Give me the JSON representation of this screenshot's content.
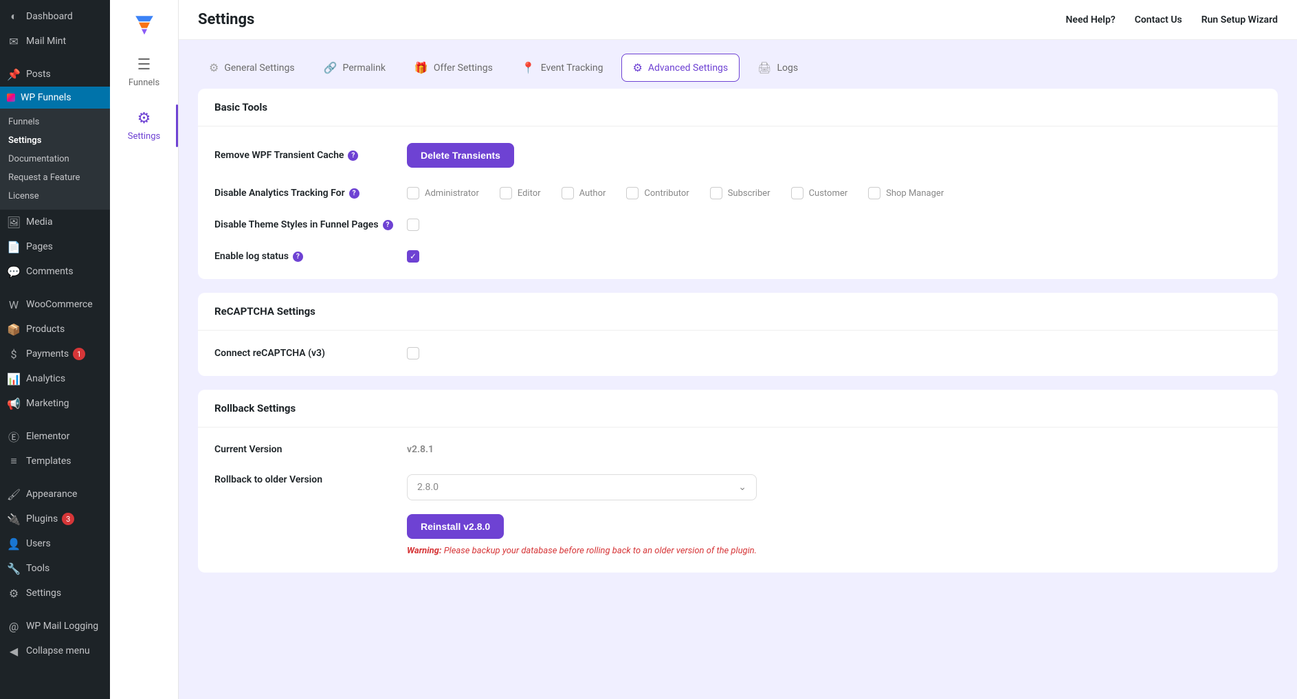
{
  "wp_sidebar": {
    "items": [
      {
        "label": "Dashboard",
        "icon": "◐"
      },
      {
        "label": "Mail Mint",
        "icon": "✉"
      },
      {
        "label": "Posts",
        "icon": "📌",
        "sep_before": true
      },
      {
        "label": "WP Funnels",
        "icon": "funnel",
        "active": true,
        "submenu": [
          {
            "label": "Funnels"
          },
          {
            "label": "Settings",
            "current": true
          },
          {
            "label": "Documentation"
          },
          {
            "label": "Request a Feature"
          },
          {
            "label": "License"
          }
        ]
      },
      {
        "label": "Media",
        "icon": "🖼"
      },
      {
        "label": "Pages",
        "icon": "📄"
      },
      {
        "label": "Comments",
        "icon": "💬"
      },
      {
        "label": "WooCommerce",
        "icon": "W",
        "sep_before": true
      },
      {
        "label": "Products",
        "icon": "📦"
      },
      {
        "label": "Payments",
        "icon": "$",
        "badge": "1"
      },
      {
        "label": "Analytics",
        "icon": "📊"
      },
      {
        "label": "Marketing",
        "icon": "📢"
      },
      {
        "label": "Elementor",
        "icon": "Ⓔ",
        "sep_before": true
      },
      {
        "label": "Templates",
        "icon": "≡"
      },
      {
        "label": "Appearance",
        "icon": "🖌",
        "sep_before": true
      },
      {
        "label": "Plugins",
        "icon": "🔌",
        "badge": "3"
      },
      {
        "label": "Users",
        "icon": "👤"
      },
      {
        "label": "Tools",
        "icon": "🔧"
      },
      {
        "label": "Settings",
        "icon": "⚙"
      },
      {
        "label": "WP Mail Logging",
        "icon": "@",
        "sep_before": true
      },
      {
        "label": "Collapse menu",
        "icon": "◀"
      }
    ]
  },
  "secondary_sidebar": {
    "items": [
      {
        "label": "Funnels",
        "icon": "☰"
      },
      {
        "label": "Settings",
        "icon": "⚙",
        "active": true
      }
    ]
  },
  "topbar": {
    "title": "Settings",
    "links": [
      {
        "label": "Need Help?"
      },
      {
        "label": "Contact Us"
      },
      {
        "label": "Run Setup Wizard"
      }
    ]
  },
  "tabs": [
    {
      "label": "General Settings",
      "icon": "⚙"
    },
    {
      "label": "Permalink",
      "icon": "🔗"
    },
    {
      "label": "Offer Settings",
      "icon": "🎁"
    },
    {
      "label": "Event Tracking",
      "icon": "📍"
    },
    {
      "label": "Advanced Settings",
      "icon": "⚙",
      "active": true
    },
    {
      "label": "Logs",
      "icon": "🖨"
    }
  ],
  "basic_tools": {
    "title": "Basic Tools",
    "remove_cache_label": "Remove WPF Transient Cache",
    "delete_button": "Delete Transients",
    "disable_analytics_label": "Disable Analytics Tracking For",
    "roles": [
      {
        "label": "Administrator"
      },
      {
        "label": "Editor"
      },
      {
        "label": "Author"
      },
      {
        "label": "Contributor"
      },
      {
        "label": "Subscriber"
      },
      {
        "label": "Customer"
      },
      {
        "label": "Shop Manager"
      }
    ],
    "disable_theme_label": "Disable Theme Styles in Funnel Pages",
    "enable_log_label": "Enable log status",
    "enable_log_checked": true
  },
  "recaptcha": {
    "title": "ReCAPTCHA Settings",
    "connect_label": "Connect reCAPTCHA (v3)"
  },
  "rollback": {
    "title": "Rollback Settings",
    "current_label": "Current Version",
    "current_value": "v2.8.1",
    "rollback_label": "Rollback to older Version",
    "select_value": "2.8.0",
    "reinstall_button": "Reinstall v2.8.0",
    "warning_prefix": "Warning:",
    "warning_text": "Please backup your database before rolling back to an older version of the plugin."
  }
}
